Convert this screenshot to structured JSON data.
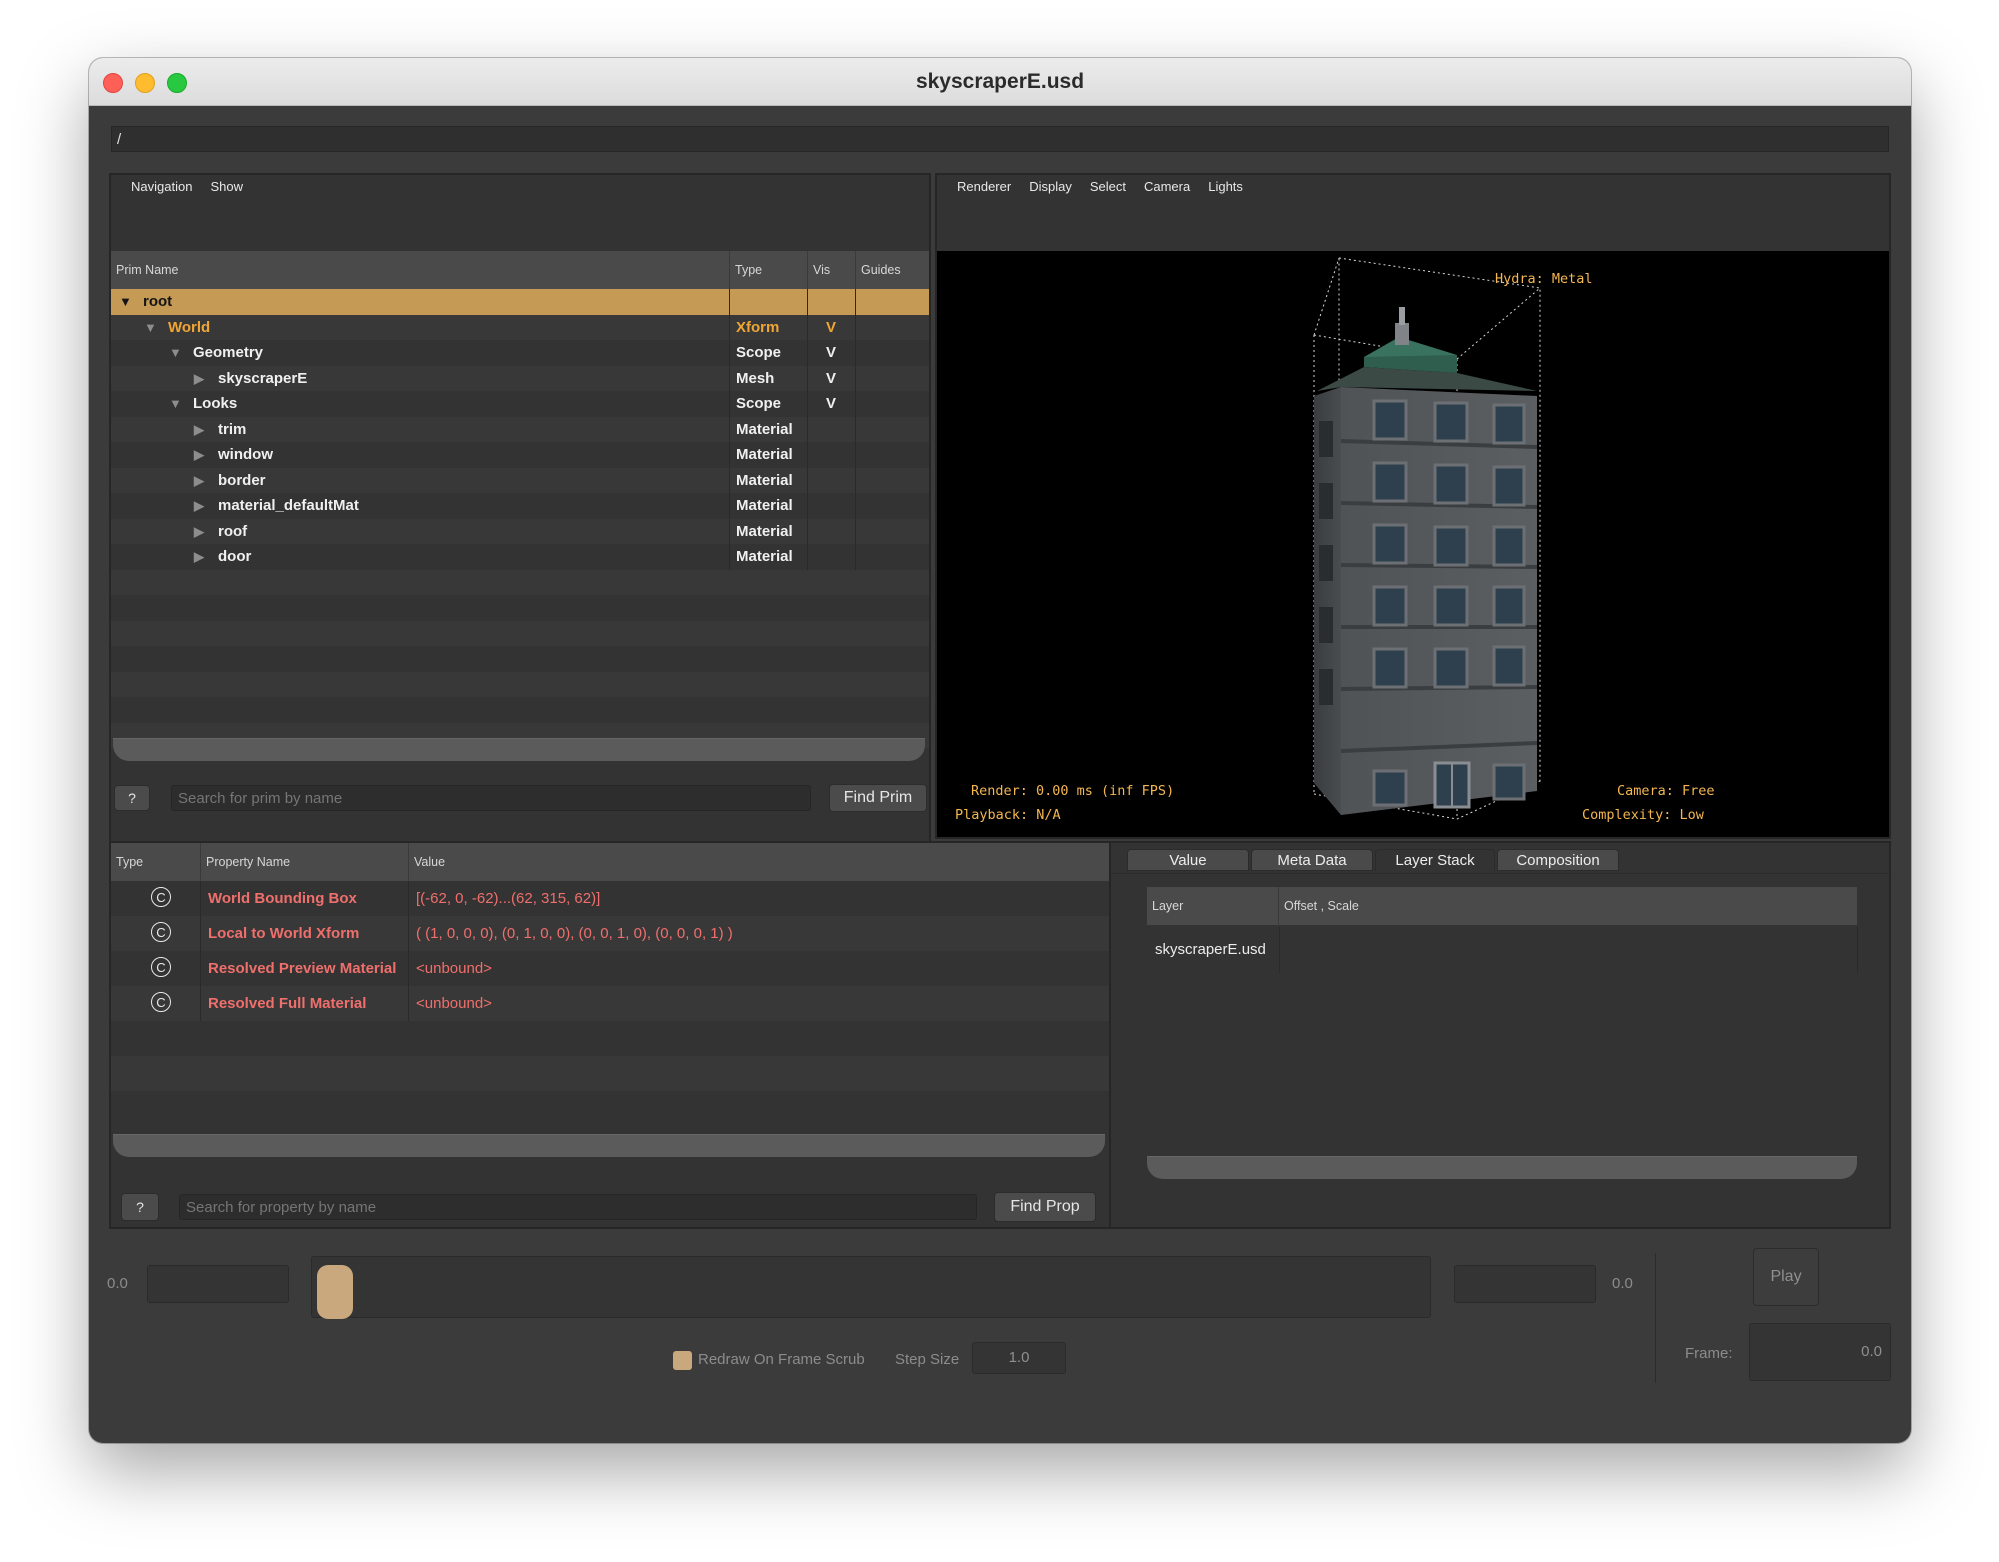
{
  "window": {
    "title": "skyscraperE.usd"
  },
  "path": "/",
  "prim_browser": {
    "menus": [
      "Navigation",
      "Show"
    ],
    "columns": [
      "Prim Name",
      "Type",
      "Vis",
      "Guides"
    ],
    "rows": [
      {
        "name": "root",
        "type": "",
        "vis": "",
        "depth": 0,
        "expander": "expanded",
        "style": "selected"
      },
      {
        "name": "World",
        "type": "Xform",
        "vis": "V",
        "depth": 1,
        "expander": "expanded",
        "style": "orange"
      },
      {
        "name": "Geometry",
        "type": "Scope",
        "vis": "V",
        "depth": 2,
        "expander": "expanded",
        "style": "normal"
      },
      {
        "name": "skyscraperE",
        "type": "Mesh",
        "vis": "V",
        "depth": 3,
        "expander": "collapsed",
        "style": "normal"
      },
      {
        "name": "Looks",
        "type": "Scope",
        "vis": "V",
        "depth": 2,
        "expander": "expanded",
        "style": "normal"
      },
      {
        "name": "trim",
        "type": "Material",
        "vis": "",
        "depth": 3,
        "expander": "collapsed",
        "style": "normal"
      },
      {
        "name": "window",
        "type": "Material",
        "vis": "",
        "depth": 3,
        "expander": "collapsed",
        "style": "normal"
      },
      {
        "name": "border",
        "type": "Material",
        "vis": "",
        "depth": 3,
        "expander": "collapsed",
        "style": "normal"
      },
      {
        "name": "material_defaultMat",
        "type": "Material",
        "vis": "",
        "depth": 3,
        "expander": "collapsed",
        "style": "normal"
      },
      {
        "name": "roof",
        "type": "Material",
        "vis": "",
        "depth": 3,
        "expander": "collapsed",
        "style": "normal"
      },
      {
        "name": "door",
        "type": "Material",
        "vis": "",
        "depth": 3,
        "expander": "collapsed",
        "style": "normal"
      }
    ],
    "help_label": "?",
    "search_placeholder": "Search for prim by name",
    "find_label": "Find Prim"
  },
  "viewer": {
    "menus": [
      "Renderer",
      "Display",
      "Select",
      "Camera",
      "Lights"
    ],
    "hud": {
      "renderer": "Hydra: Metal",
      "render_time": "Render: 0.00 ms (inf FPS)",
      "playback": "Playback: N/A",
      "camera": "Camera: Free",
      "complexity": "Complexity: Low"
    }
  },
  "properties": {
    "columns": [
      "Type",
      "Property Name",
      "Value"
    ],
    "rows": [
      {
        "icon": "C",
        "name": "World Bounding Box",
        "value": "[(-62, 0, -62)...(62, 315, 62)]"
      },
      {
        "icon": "C",
        "name": "Local to World Xform",
        "value": "( (1, 0, 0, 0), (0, 1, 0, 0), (0, 0, 1, 0), (0, 0, 0, 1) )"
      },
      {
        "icon": "C",
        "name": "Resolved Preview Material",
        "value": "<unbound>"
      },
      {
        "icon": "C",
        "name": "Resolved Full Material",
        "value": "<unbound>"
      }
    ],
    "help_label": "?",
    "search_placeholder": "Search for property by name",
    "find_label": "Find Prop"
  },
  "inspector": {
    "tabs": [
      "Value",
      "Meta Data",
      "Layer Stack",
      "Composition"
    ],
    "active_tab": "Layer Stack",
    "columns": [
      "Layer",
      "Offset , Scale"
    ],
    "rows": [
      {
        "layer": "skyscraperE.usd",
        "offset": ""
      }
    ]
  },
  "timeline": {
    "start_value": "0.0",
    "end_value": "0.0",
    "slider_fraction": 0.0,
    "redraw_label": "Redraw On Frame Scrub",
    "redraw_checked": false,
    "step_label": "Step Size",
    "step_value": "1.0",
    "play_label": "Play",
    "frame_label": "Frame:",
    "frame_value": "0.0"
  },
  "colors": {
    "selected_row": "#c49a55",
    "orange_text": "#f0a634",
    "property_text": "#ef6f6c",
    "hud_text": "#f3b652",
    "background": "#3b3b3b"
  }
}
